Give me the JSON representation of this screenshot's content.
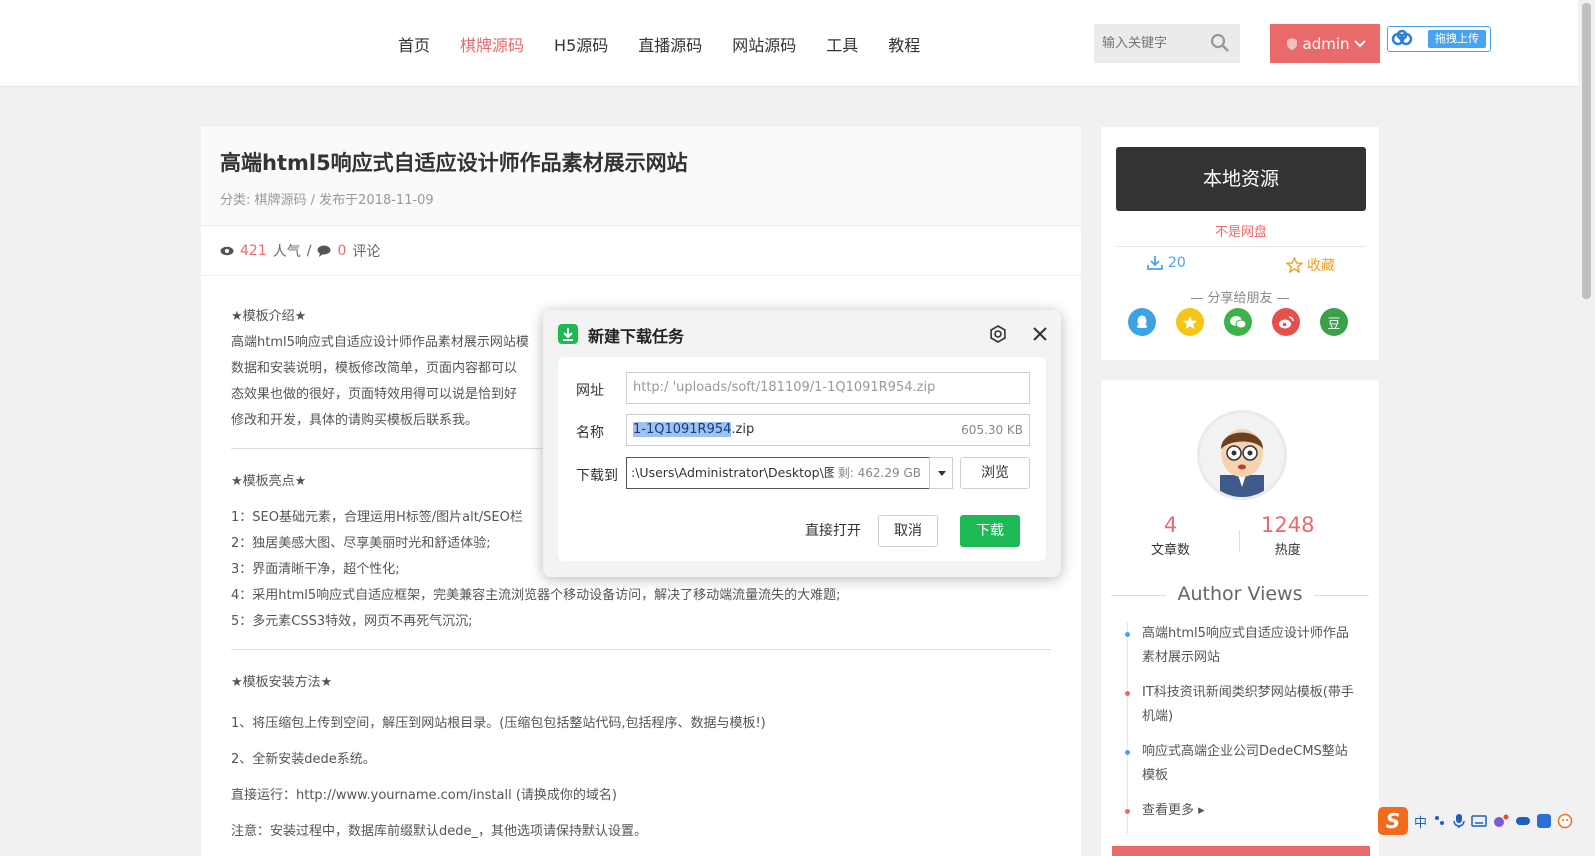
{
  "header": {
    "nav": [
      "首页",
      "棋牌源码",
      "H5源码",
      "直播源码",
      "网站源码",
      "工具",
      "教程"
    ],
    "search_placeholder": "输入关键字",
    "admin_label": "admin",
    "upload_label": "拖拽上传"
  },
  "article": {
    "title": "高端html5响应式自适应设计师作品素材展示网站",
    "meta": "分类: 棋牌源码 / 发布于2018-11-09",
    "views": "421",
    "views_label": "人气",
    "sep": "/",
    "comments": "0",
    "comments_label": "评论",
    "intro_heading": "★模板介绍★",
    "intro_lines": [
      "高端html5响应式自适应设计师作品素材展示网站模",
      "数据和安装说明，模板修改简单，页面内容都可以",
      "态效果也做的很好，页面特效用得可以说是恰到好",
      "修改和开发，具体的请购买模板后联系我。"
    ],
    "highlights_heading": "★模板亮点★",
    "highlights": [
      "1：SEO基础元素，合理运用H标签/图片alt/SEO栏",
      "2：独居美感大图、尽享美丽时光和舒适体验;",
      "3：界面清晰干净，超个性化;",
      "4：采用html5响应式自适应框架，完美兼容主流浏览器个移动设备访问，解决了移动端流量流失的大难题;",
      "5：多元素CSS3特效，网页不再死气沉沉;"
    ],
    "install_heading": "★模板安装方法★",
    "install_lines": [
      "1、将压缩包上传到空间，解压到网站根目录。(压缩包包括整站代码,包括程序、数据与模板!)",
      "2、全新安装dede系统。",
      "直接运行：http://www.yourname.com/install (请换成你的域名)",
      "注意：安装过程中，数据库前缀默认dede_，其他选项请保持默认设置。"
    ]
  },
  "sidebar": {
    "local_button": "本地资源",
    "not_pan": "不是网盘",
    "download_count": "20",
    "favorite": "收藏",
    "share_title": "— 分享给朋友 —",
    "share_douban": "豆",
    "articles_count": "4",
    "articles_label": "文章数",
    "heat_count": "1248",
    "heat_label": "热度",
    "views_title": "Author Views",
    "views_list": [
      "高端html5响应式自适应设计师作品素材展示网站",
      "IT科技资讯新闻类织梦网站模板(带手机端)",
      "响应式高端企业公司DedeCMS整站模板",
      "查看更多 ▸"
    ]
  },
  "dialog": {
    "title": "新建下载任务",
    "url_label": "网址",
    "url_value": "http:/            'uploads/soft/181109/1-1Q1091R954.zip",
    "name_label": "名称",
    "name_selected": "1-1Q1091R954",
    "name_ext": ".zip",
    "name_size": "605.30 KB",
    "path_label": "下载到",
    "path_value": ":\\Users\\Administrator\\Desktop\\图片",
    "path_free": "剩: 462.29 GB",
    "browse": "浏览",
    "open_direct": "直接打开",
    "cancel": "取消",
    "download": "下载"
  },
  "ime": {
    "zh": "中"
  },
  "colors": {
    "accent": "#e96a6a",
    "blue": "#4aa3ef",
    "green": "#1db954"
  }
}
